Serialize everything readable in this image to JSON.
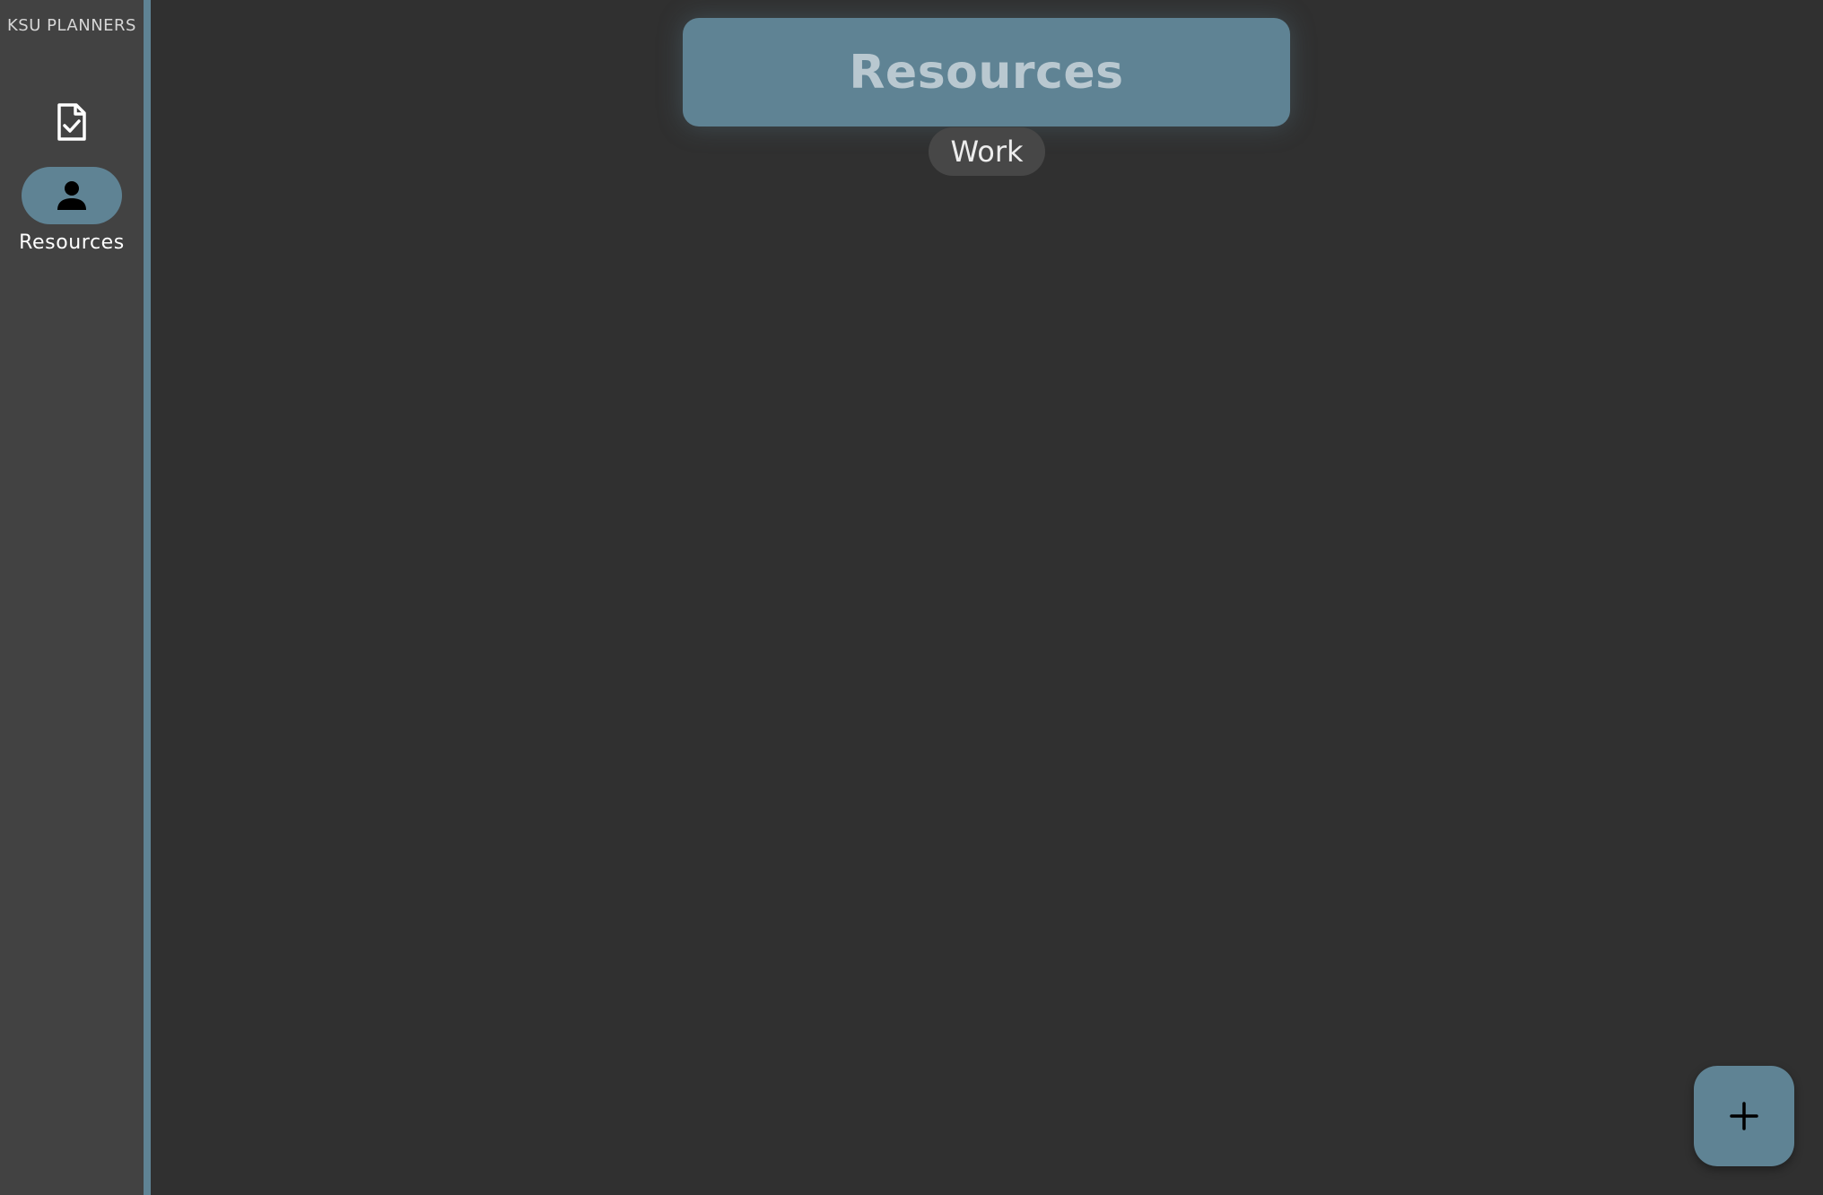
{
  "app": {
    "brand": "KSU PLANNERS"
  },
  "sidebar": {
    "items": [
      {
        "icon": "task-document-icon",
        "label": "",
        "selected": false
      },
      {
        "icon": "person-icon",
        "label": "Resources",
        "selected": true
      }
    ]
  },
  "main": {
    "title": "Resources",
    "chip_label": "Work",
    "fab_icon": "plus-icon"
  },
  "colors": {
    "background": "#303030",
    "sidebar": "#424242",
    "accent": "#5f8394",
    "chip": "#474747"
  }
}
